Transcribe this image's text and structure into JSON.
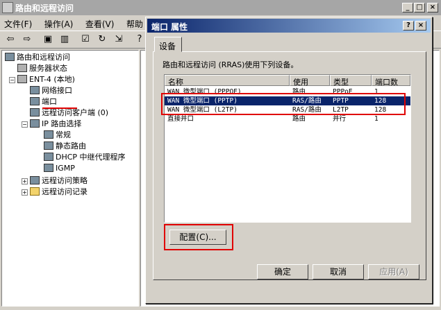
{
  "window": {
    "title": "路由和远程访问"
  },
  "menu": [
    "文件(F)",
    "操作(A)",
    "查看(V)",
    "帮助"
  ],
  "tree": {
    "root": "路由和远程访问",
    "server_status": "服务器状态",
    "server": "ENT-4 (本地)",
    "network_interfaces": "网络接口",
    "ports": "端口",
    "remote_clients": "远程访问客户端 (0)",
    "ip_routing": "IP 路由选择",
    "general": "常规",
    "static_routes": "静态路由",
    "dhcp_relay": "DHCP 中继代理程序",
    "igmp": "IGMP",
    "remote_policies": "远程访问策略",
    "remote_logging": "远程访问记录"
  },
  "dialog": {
    "title": "端口 属性",
    "help_btn": "?",
    "close_btn": "×",
    "tab_label": "设备",
    "description": "路由和远程访问 (RRAS)使用下列设备。",
    "columns": [
      "名称",
      "使用",
      "类型",
      "端口数"
    ],
    "rows": [
      [
        "WAN 微型端口 (PPPOE)",
        "路由",
        "PPPoE",
        "1"
      ],
      [
        "WAN 微型端口 (PPTP)",
        "RAS/路由",
        "PPTP",
        "128"
      ],
      [
        "WAN 微型端口 (L2TP)",
        "RAS/路由",
        "L2TP",
        "128"
      ],
      [
        "直接并口",
        "路由",
        "并行",
        "1"
      ]
    ],
    "configure_btn": "配置(C)...",
    "ok_btn": "确定",
    "cancel_btn": "取消",
    "apply_btn": "应用(A)"
  },
  "colors": {
    "title_active": "#0a246a",
    "selection": "#0a246a",
    "highlight_box": "#e00000"
  }
}
